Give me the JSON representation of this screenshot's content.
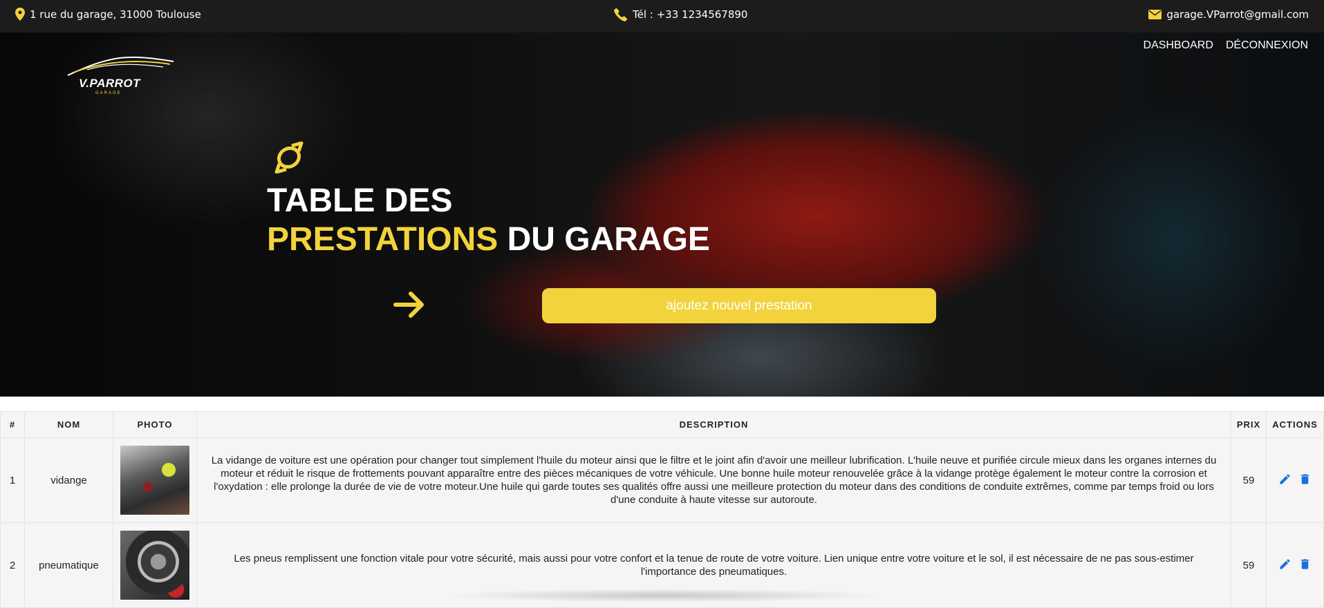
{
  "topbar": {
    "address": "1 rue du garage, 31000 Toulouse",
    "phone": "Tél : +33 1234567890",
    "email": "garage.VParrot@gmail.com"
  },
  "logo": {
    "brand": "V.PARROT",
    "subtitle": "GARAGE"
  },
  "nav": {
    "items": [
      "DASHBOARD",
      "DÉCONNEXION"
    ]
  },
  "hero": {
    "title_line1": "TABLE DES",
    "title_highlight": "PRESTATIONS",
    "title_rest": " DU GARAGE",
    "add_button": "ajoutez nouvel prestation"
  },
  "table": {
    "headers": [
      "#",
      "NOM",
      "PHOTO",
      "DESCRIPTION",
      "PRIX",
      "ACTIONS"
    ],
    "rows": [
      {
        "id": "1",
        "name": "vidange",
        "description": "La vidange de voiture est une opération pour changer tout simplement l'huile du moteur ainsi que le filtre et le joint afin d'avoir une meilleur lubrification. L'huile neuve et purifiée circule mieux dans les organes internes du moteur et réduit le risque de frottements pouvant apparaître entre des pièces mécaniques de votre véhicule. Une bonne huile moteur renouvelée grâce à la vidange protège également le moteur contre la corrosion et l'oxydation : elle prolonge la durée de vie de votre moteur.Une huile qui garde toutes ses qualités offre aussi une meilleure protection du moteur dans des conditions de conduite extrêmes, comme par temps froid ou lors d'une conduite à haute vitesse sur autoroute.",
        "price": "59"
      },
      {
        "id": "2",
        "name": "pneumatique",
        "description": "Les pneus remplissent une fonction vitale pour votre sécurité, mais aussi pour votre confort et la tenue de route de votre voiture. Lien unique entre votre voiture et le sol, il est nécessaire de ne pas sous-estimer l'importance des pneumatiques.",
        "price": "59"
      }
    ]
  },
  "colors": {
    "accent_yellow": "#f3d33c",
    "topbar_bg": "#1c1c1c",
    "action_blue": "#1a6fe0"
  },
  "icons": {
    "address": "map-pin-icon",
    "phone": "phone-icon",
    "email": "envelope-icon",
    "hero_deco": "swirl-icon",
    "hero_arrow": "arrow-right-icon",
    "edit": "pencil-icon",
    "delete": "trash-icon"
  }
}
